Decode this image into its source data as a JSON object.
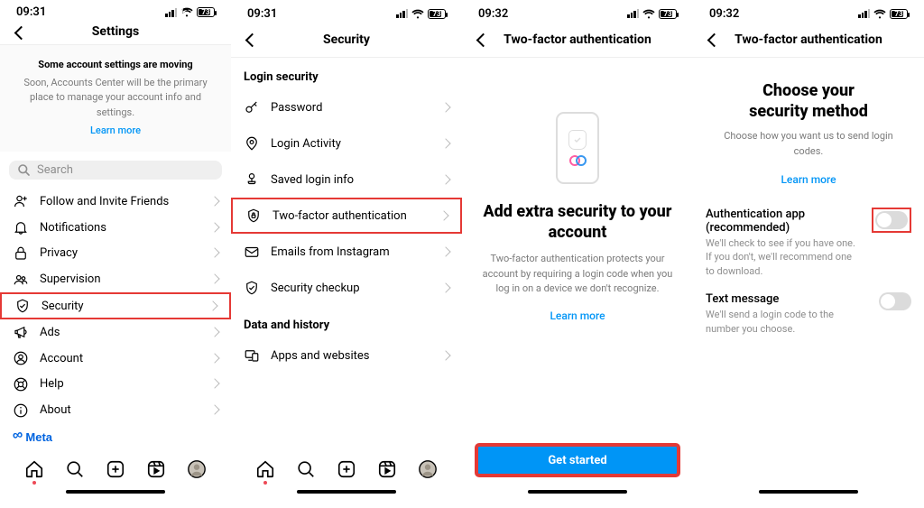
{
  "status": {
    "time_a": "09:31",
    "time_b": "09:31",
    "time_c": "09:32",
    "time_d": "09:32",
    "battery": "73"
  },
  "panel1": {
    "title": "Settings",
    "banner_hd": "Some account settings are moving",
    "banner_body": "Soon, Accounts Center will be the primary place to manage your account info and settings.",
    "learn_more": "Learn more",
    "search_placeholder": "Search",
    "items": [
      {
        "label": "Follow and Invite Friends"
      },
      {
        "label": "Notifications"
      },
      {
        "label": "Privacy"
      },
      {
        "label": "Supervision"
      },
      {
        "label": "Security"
      },
      {
        "label": "Ads"
      },
      {
        "label": "Account"
      },
      {
        "label": "Help"
      },
      {
        "label": "About"
      }
    ],
    "meta": "Meta"
  },
  "panel2": {
    "title": "Security",
    "section_a": "Login security",
    "section_b": "Data and history",
    "items_a": [
      {
        "label": "Password"
      },
      {
        "label": "Login Activity"
      },
      {
        "label": "Saved login info"
      },
      {
        "label": "Two-factor authentication"
      },
      {
        "label": "Emails from Instagram"
      },
      {
        "label": "Security checkup"
      }
    ],
    "items_b": [
      {
        "label": "Apps and websites"
      }
    ]
  },
  "panel3": {
    "title": "Two-factor authentication",
    "heading": "Add extra security to your account",
    "body": "Two-factor authentication protects your account by requiring a login code when you log in on a device we don't recognize.",
    "learn_more": "Learn more",
    "cta": "Get started"
  },
  "panel4": {
    "title": "Two-factor authentication",
    "heading_l1": "Choose your",
    "heading_l2": "security method",
    "sub": "Choose how you want us to send login codes.",
    "learn_more": "Learn more",
    "opt1_title": "Authentication app (recommended)",
    "opt1_desc": "We'll check to see if you have one. If you don't, we'll recommend one to download.",
    "opt2_title": "Text message",
    "opt2_desc": "We'll send a login code to the number you choose."
  }
}
